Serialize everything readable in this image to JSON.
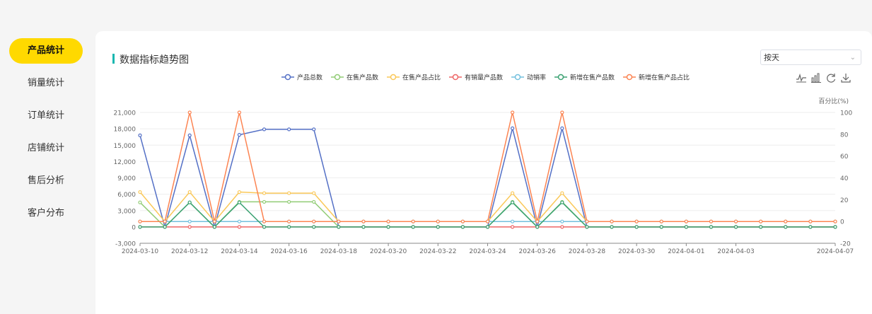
{
  "sidebar": {
    "items": [
      {
        "label": "产品统计",
        "active": true
      },
      {
        "label": "销量统计",
        "active": false
      },
      {
        "label": "订单统计",
        "active": false
      },
      {
        "label": "店铺统计",
        "active": false
      },
      {
        "label": "售后分析",
        "active": false
      },
      {
        "label": "客户分布",
        "active": false
      }
    ]
  },
  "panel": {
    "title": "数据指标趋势图",
    "select_value": "按天"
  },
  "toolbox": [
    "line-chart-icon",
    "bar-chart-icon",
    "restore-icon",
    "download-icon"
  ],
  "colors": {
    "accent": "#ffd900",
    "title_bar": "#19b7b0"
  },
  "chart_data": {
    "type": "line",
    "x": [
      "2024-03-10",
      "2024-03-11",
      "2024-03-12",
      "2024-03-13",
      "2024-03-14",
      "2024-03-15",
      "2024-03-16",
      "2024-03-17",
      "2024-03-18",
      "2024-03-19",
      "2024-03-20",
      "2024-03-21",
      "2024-03-22",
      "2024-03-23",
      "2024-03-24",
      "2024-03-25",
      "2024-03-26",
      "2024-03-27",
      "2024-03-28",
      "2024-03-29",
      "2024-03-30",
      "2024-03-31",
      "2024-04-01",
      "2024-04-02",
      "2024-04-03",
      "2024-04-04",
      "2024-04-05",
      "2024-04-06",
      "2024-04-07"
    ],
    "xticks": [
      "2024-03-10",
      "2024-03-12",
      "2024-03-14",
      "2024-03-16",
      "2024-03-18",
      "2024-03-20",
      "2024-03-22",
      "2024-03-24",
      "2024-03-26",
      "2024-03-28",
      "2024-03-30",
      "2024-04-01",
      "2024-04-03",
      "2024-04-07"
    ],
    "xtick_indices": [
      0,
      2,
      4,
      6,
      8,
      10,
      12,
      14,
      16,
      18,
      20,
      22,
      24,
      28
    ],
    "y_left": {
      "min": -3000,
      "max": 21000,
      "ticks": [
        -3000,
        0,
        3000,
        6000,
        9000,
        12000,
        15000,
        18000,
        21000
      ]
    },
    "y_right": {
      "label": "百分比(%)",
      "min": -20,
      "max": 100,
      "ticks": [
        -20,
        0,
        20,
        40,
        60,
        80,
        100
      ]
    },
    "legend_position": "top",
    "series": [
      {
        "name": "产品总数",
        "color": "#5470c6",
        "axis": "left",
        "values": [
          16800,
          0,
          16800,
          0,
          16900,
          17900,
          17900,
          17900,
          0,
          0,
          0,
          0,
          0,
          0,
          0,
          18100,
          0,
          18100,
          0,
          0,
          0,
          0,
          0,
          0,
          0,
          0,
          0,
          0,
          0
        ]
      },
      {
        "name": "在售产品数",
        "color": "#91cc75",
        "axis": "left",
        "values": [
          4500,
          0,
          4500,
          0,
          4600,
          4600,
          4600,
          4600,
          0,
          0,
          0,
          0,
          0,
          0,
          0,
          4600,
          0,
          4600,
          0,
          0,
          0,
          0,
          0,
          0,
          0,
          0,
          0,
          0,
          0
        ]
      },
      {
        "name": "在售产品占比",
        "color": "#fac858",
        "axis": "right",
        "values": [
          27,
          0,
          27,
          0,
          27,
          26,
          26,
          26,
          0,
          0,
          0,
          0,
          0,
          0,
          0,
          26,
          0,
          26,
          0,
          0,
          0,
          0,
          0,
          0,
          0,
          0,
          0,
          0,
          0
        ]
      },
      {
        "name": "有销量产品数",
        "color": "#ee6666",
        "axis": "left",
        "values": [
          0,
          0,
          0,
          0,
          0,
          0,
          0,
          0,
          0,
          0,
          0,
          0,
          0,
          0,
          0,
          0,
          0,
          0,
          0,
          0,
          0,
          0,
          0,
          0,
          0,
          0,
          0,
          0,
          0
        ]
      },
      {
        "name": "动销率",
        "color": "#73c0de",
        "axis": "right",
        "values": [
          0,
          0,
          0,
          0,
          0,
          0,
          0,
          0,
          0,
          0,
          0,
          0,
          0,
          0,
          0,
          0,
          0,
          0,
          0,
          0,
          0,
          0,
          0,
          0,
          0,
          0,
          0,
          0,
          0
        ]
      },
      {
        "name": "新增在售产品数",
        "color": "#3ba272",
        "axis": "left",
        "values": [
          0,
          0,
          4500,
          0,
          4500,
          0,
          0,
          0,
          0,
          0,
          0,
          0,
          0,
          0,
          0,
          4500,
          0,
          4500,
          0,
          0,
          0,
          0,
          0,
          0,
          0,
          0,
          0,
          0,
          0
        ]
      },
      {
        "name": "新增在售产品占比",
        "color": "#fc8452",
        "axis": "right",
        "values": [
          0,
          0,
          100,
          0,
          100,
          0,
          0,
          0,
          0,
          0,
          0,
          0,
          0,
          0,
          0,
          100,
          0,
          100,
          0,
          0,
          0,
          0,
          0,
          0,
          0,
          0,
          0,
          0,
          0
        ]
      }
    ]
  }
}
